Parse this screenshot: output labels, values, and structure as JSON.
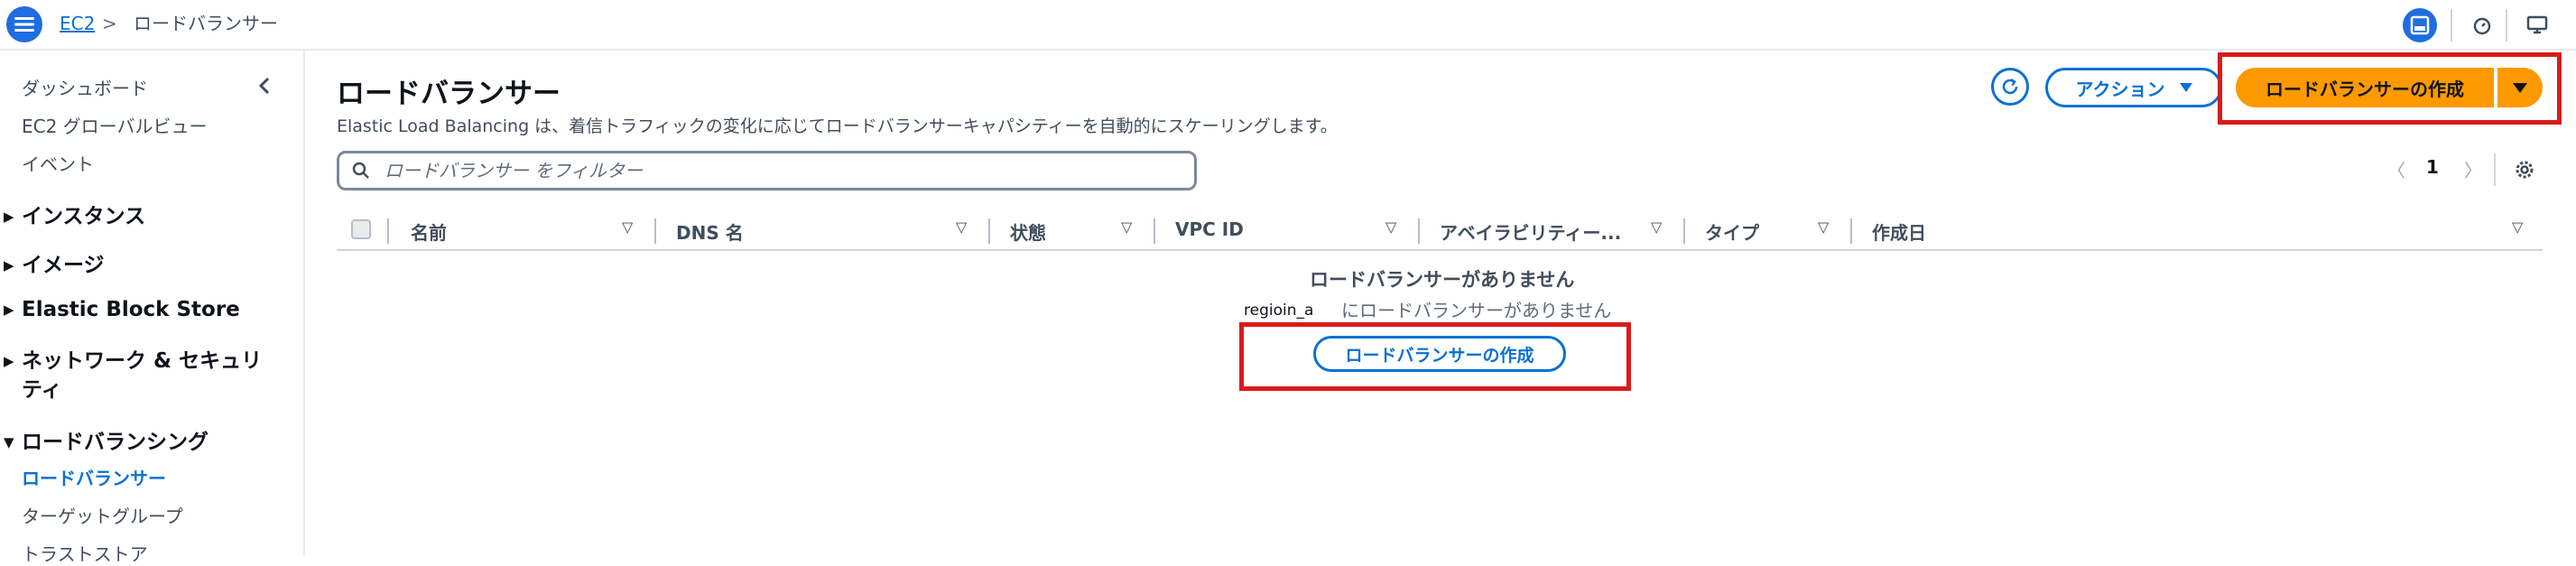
{
  "breadcrumb": {
    "root": "EC2",
    "separator": ">",
    "current": "ロードバランサー"
  },
  "sidebar": {
    "items": [
      {
        "label": "ダッシュボード"
      },
      {
        "label": "EC2 グローバルビュー"
      },
      {
        "label": "イベント"
      }
    ],
    "sections": [
      {
        "label": "インスタンス",
        "expanded": false
      },
      {
        "label": "イメージ",
        "expanded": false
      },
      {
        "label": "Elastic Block Store",
        "expanded": false
      },
      {
        "label_line1": "ネットワーク & セキュリ",
        "label_line2": "ティ",
        "expanded": false
      },
      {
        "label": "ロードバランシング",
        "expanded": true
      }
    ],
    "lb_items": [
      {
        "label": "ロードバランサー",
        "active": true
      },
      {
        "label": "ターゲットグループ"
      },
      {
        "label": "トラストストア"
      }
    ]
  },
  "main": {
    "title": "ロードバランサー",
    "description": "Elastic Load Balancing は、着信トラフィックの変化に応じてロードバランサーキャパシティーを自動的にスケーリングします。",
    "actions_label": "アクション",
    "create_label": "ロードバランサーの作成",
    "search_placeholder": "ロードバランサー をフィルター",
    "page_number": "1"
  },
  "table": {
    "columns": [
      "名前",
      "DNS 名",
      "状態",
      "VPC ID",
      "アベイラビリティー...",
      "タイプ",
      "作成日"
    ]
  },
  "empty_state": {
    "title": "ロードバランサーがありません",
    "region": "regioin_a",
    "subtitle": "にロードバランサーがありません",
    "create_label": "ロードバランサーの作成"
  },
  "colors": {
    "primary_blue": "#0972d3",
    "create_orange": "#ff9900",
    "highlight_red": "#d91b1b"
  }
}
